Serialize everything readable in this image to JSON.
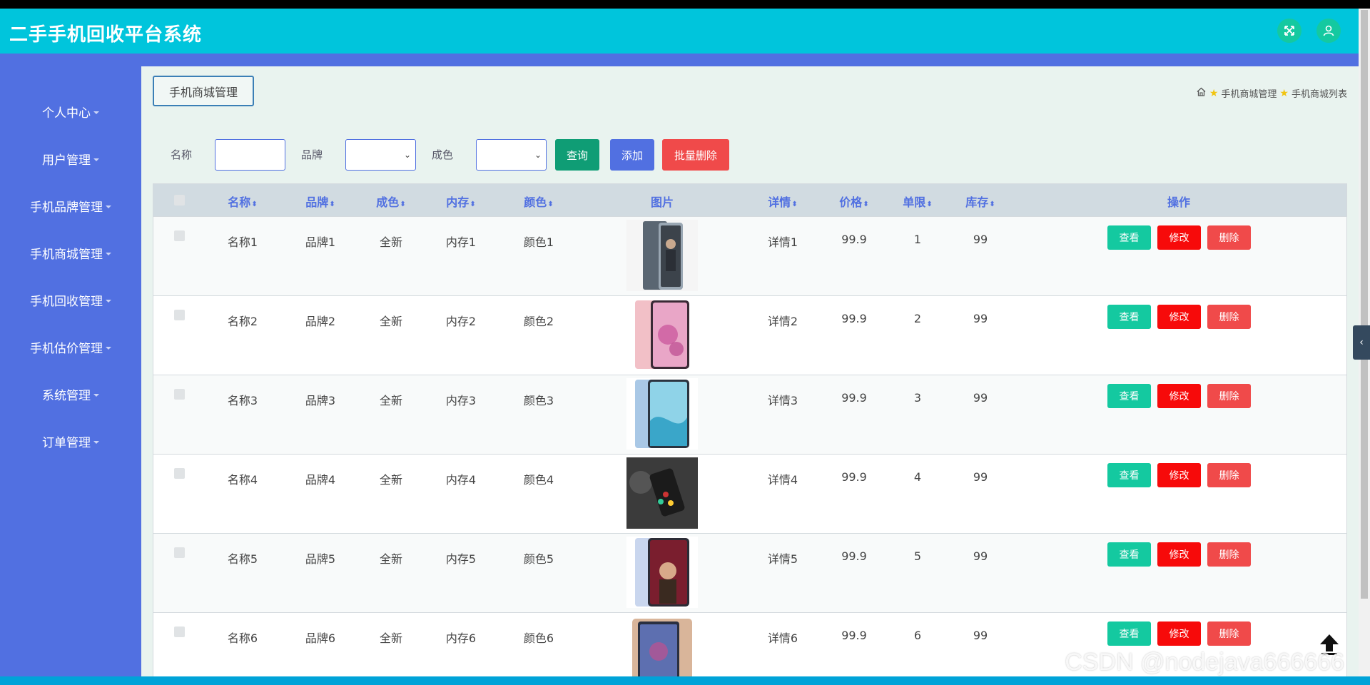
{
  "app": {
    "title": "二手手机回收平台系统"
  },
  "sidebar": {
    "items": [
      {
        "label": "个人中心"
      },
      {
        "label": "用户管理"
      },
      {
        "label": "手机品牌管理"
      },
      {
        "label": "手机商城管理"
      },
      {
        "label": "手机回收管理"
      },
      {
        "label": "手机估价管理"
      },
      {
        "label": "系统管理"
      },
      {
        "label": "订单管理"
      }
    ]
  },
  "tab": {
    "label": "手机商城管理"
  },
  "breadcrumb": {
    "level1": "手机商城管理",
    "level2": "手机商城列表"
  },
  "search": {
    "name_label": "名称",
    "brand_label": "品牌",
    "condition_label": "成色",
    "name_value": "",
    "brand_value": "",
    "condition_value": "",
    "query_button": "查询",
    "add_button": "添加",
    "batch_delete_button": "批量删除"
  },
  "table": {
    "headers": {
      "name": "名称",
      "brand": "品牌",
      "condition": "成色",
      "memory": "内存",
      "color": "颜色",
      "image": "图片",
      "details": "详情",
      "price": "价格",
      "limit": "单限",
      "stock": "库存",
      "actions": "操作"
    },
    "rows": [
      {
        "name": "名称1",
        "brand": "品牌1",
        "condition": "全新",
        "memory": "内存1",
        "color": "颜色1",
        "details": "详情1",
        "price": "99.9",
        "limit": "1",
        "stock": "99"
      },
      {
        "name": "名称2",
        "brand": "品牌2",
        "condition": "全新",
        "memory": "内存2",
        "color": "颜色2",
        "details": "详情2",
        "price": "99.9",
        "limit": "2",
        "stock": "99"
      },
      {
        "name": "名称3",
        "brand": "品牌3",
        "condition": "全新",
        "memory": "内存3",
        "color": "颜色3",
        "details": "详情3",
        "price": "99.9",
        "limit": "3",
        "stock": "99"
      },
      {
        "name": "名称4",
        "brand": "品牌4",
        "condition": "全新",
        "memory": "内存4",
        "color": "颜色4",
        "details": "详情4",
        "price": "99.9",
        "limit": "4",
        "stock": "99"
      },
      {
        "name": "名称5",
        "brand": "品牌5",
        "condition": "全新",
        "memory": "内存5",
        "color": "颜色5",
        "details": "详情5",
        "price": "99.9",
        "limit": "5",
        "stock": "99"
      },
      {
        "name": "名称6",
        "brand": "品牌6",
        "condition": "全新",
        "memory": "内存6",
        "color": "颜色6",
        "details": "详情6",
        "price": "99.9",
        "limit": "6",
        "stock": "99"
      }
    ],
    "actions": {
      "view": "查看",
      "edit": "修改",
      "delete": "删除"
    }
  },
  "watermark": "CSDN @nodejava666666",
  "colors": {
    "topbar": "#00c5dc",
    "sidebar": "#5170e1",
    "view_button": "#14c9a0",
    "edit_button": "#f70a0a",
    "delete_button": "#f04a4a",
    "add_button": "#5170e1",
    "query_button": "#0f9d75",
    "batch_delete_button": "#f04a4a"
  },
  "icons": {
    "fullscreen": "expand-arrows-icon",
    "user": "user-icon",
    "home": "home-icon",
    "breadcrumb_separator": "star-icon",
    "scroll_top": "up-arrow-icon",
    "collapse": "chevron-left-icon"
  }
}
